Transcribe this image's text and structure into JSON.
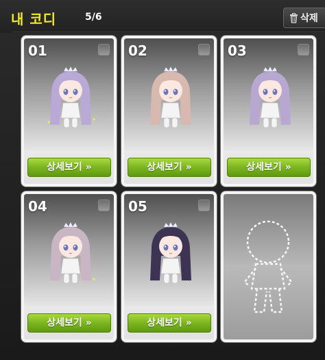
{
  "header": {
    "title": "내 코디",
    "count": "5/6",
    "delete_label": "삭제"
  },
  "cards": [
    {
      "number": "01",
      "button_label": "상세보기 »",
      "hair_color": "#b9a9d6"
    },
    {
      "number": "02",
      "button_label": "상세보기 »",
      "hair_color": "#d8b9b0"
    },
    {
      "number": "03",
      "button_label": "상세보기 »",
      "hair_color": "#b6a8d0"
    },
    {
      "number": "04",
      "button_label": "상세보기 »",
      "hair_color": "#c8b6c2"
    },
    {
      "number": "05",
      "button_label": "상세보기 »",
      "hair_color": "#3d3352"
    }
  ],
  "colors": {
    "title": "#f2ea22",
    "button": "#7bb51f"
  }
}
